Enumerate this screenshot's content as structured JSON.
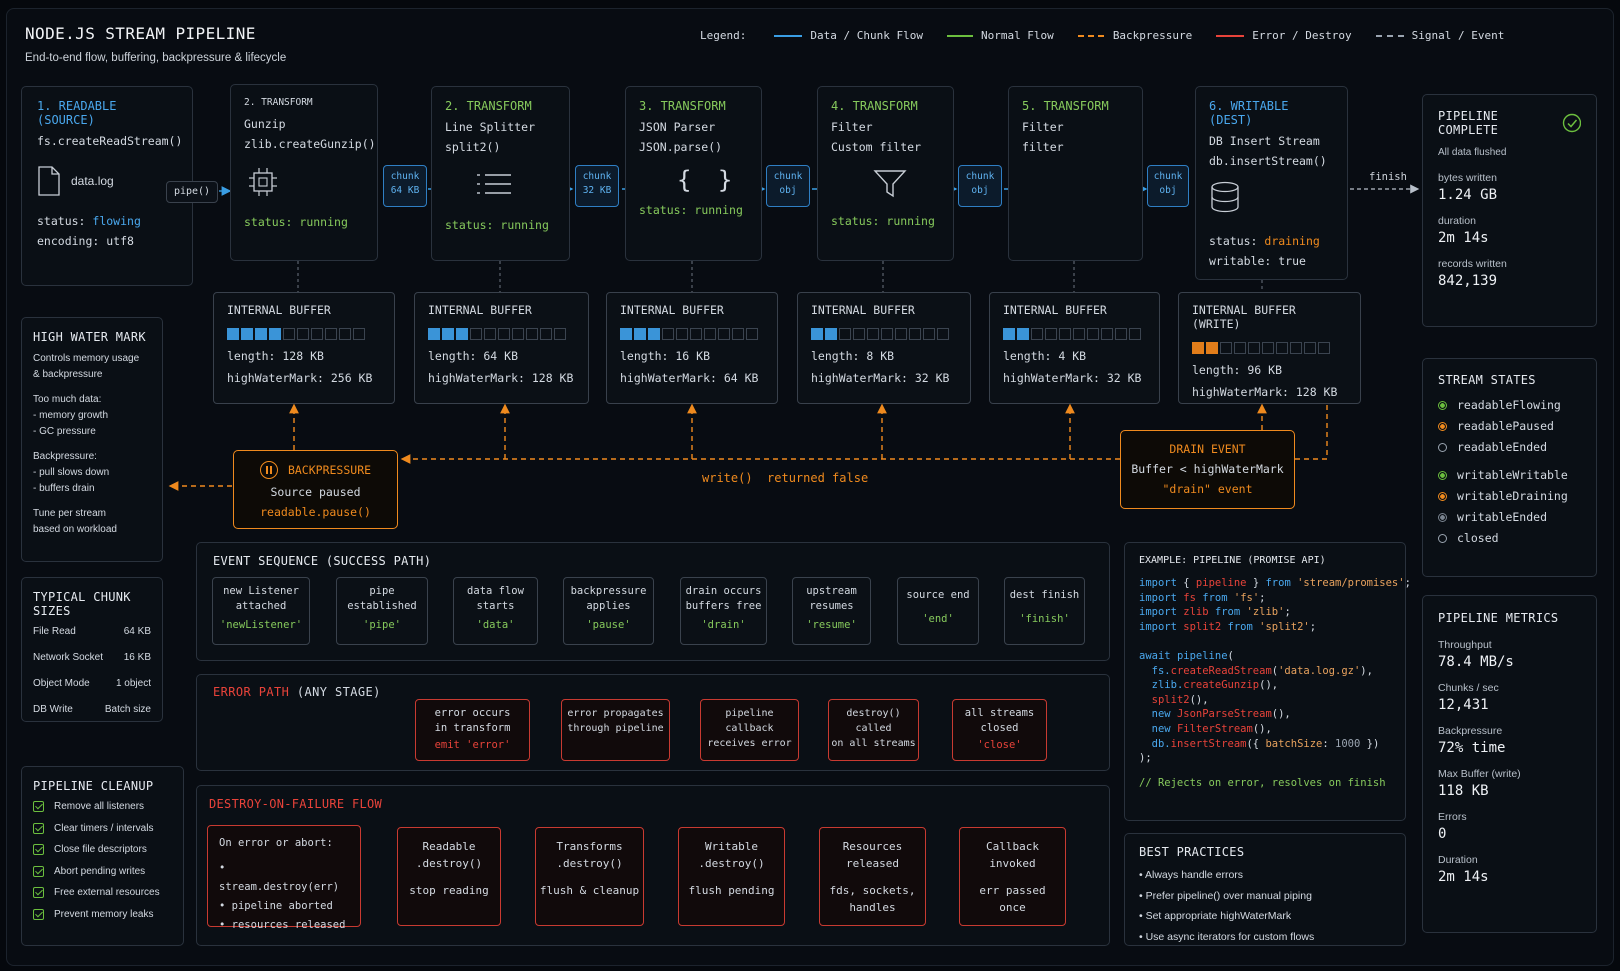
{
  "header": {
    "title": "NODE.JS STREAM PIPELINE",
    "subtitle": "End-to-end flow, buffering, backpressure & lifecycle"
  },
  "legend": {
    "label": "Legend:",
    "items": [
      {
        "label": "Data / Chunk Flow",
        "color": "#3a9ee4",
        "style": "solid"
      },
      {
        "label": "Normal Flow",
        "color": "#6cbf3e",
        "style": "solid"
      },
      {
        "label": "Backpressure",
        "color": "#ef8a1e",
        "style": "dashed"
      },
      {
        "label": "Error / Destroy",
        "color": "#e8433a",
        "style": "solid"
      },
      {
        "label": "Signal / Event",
        "color": "#9aa4b0",
        "style": "dashed"
      }
    ]
  },
  "source": {
    "title": "1. READABLE (SOURCE)",
    "api": "fs.createReadStream()",
    "file": "data.log",
    "status_label": "status:",
    "status": "flowing",
    "encoding": "encoding: utf8",
    "pipe": "pipe()"
  },
  "stages": [
    {
      "title": "2. TRANSFORM",
      "name": "Gunzip",
      "api": "zlib.createGunzip()",
      "icon": "cpu-icon",
      "status_label": "status:",
      "status": "running"
    },
    {
      "title": "2. TRANSFORM",
      "name": "Line Splitter",
      "api": "split2()",
      "icon": "list-icon",
      "status_label": "status:",
      "status": "running"
    },
    {
      "title": "3. TRANSFORM",
      "name": "JSON Parser",
      "api": "JSON.parse()",
      "icon": "braces-icon",
      "status_label": "status:",
      "status": "running"
    },
    {
      "title": "4. TRANSFORM",
      "name": "Filter",
      "api": "Custom filter",
      "icon": "funnel-icon",
      "status_label": "status:",
      "status": "running"
    },
    {
      "title": "5. TRANSFORM",
      "name": "Filter",
      "api": "filter",
      "icon": "",
      "status_label": "",
      "status": ""
    }
  ],
  "chunks": [
    {
      "l1": "chunk",
      "l2": "64 KB"
    },
    {
      "l1": "chunk",
      "l2": "32 KB"
    },
    {
      "l1": "chunk",
      "l2": "obj"
    },
    {
      "l1": "chunk",
      "l2": "obj"
    },
    {
      "l1": "chunk",
      "l2": "obj"
    }
  ],
  "writable": {
    "title": "6. WRITABLE (DEST)",
    "name": "DB Insert Stream",
    "api": "db.insertStream()",
    "status_label": "status:",
    "status": "draining",
    "writable": "writable: true",
    "finish": "finish"
  },
  "buffers": [
    {
      "title": "INTERNAL BUFFER",
      "length": "length: 128 KB",
      "hwm": "highWaterMark: 256 KB",
      "fill": 4
    },
    {
      "title": "INTERNAL BUFFER",
      "length": "length: 64 KB",
      "hwm": "highWaterMark: 128 KB",
      "fill": 3
    },
    {
      "title": "INTERNAL BUFFER",
      "length": "length: 16 KB",
      "hwm": "highWaterMark: 64 KB",
      "fill": 3
    },
    {
      "title": "INTERNAL BUFFER",
      "length": "length: 8 KB",
      "hwm": "highWaterMark: 32 KB",
      "fill": 2
    },
    {
      "title": "INTERNAL BUFFER",
      "length": "length: 4 KB",
      "hwm": "highWaterMark: 32 KB",
      "fill": 2
    },
    {
      "title": "INTERNAL BUFFER (WRITE)",
      "length": "length: 96 KB",
      "hwm": "highWaterMark: 128 KB",
      "fill": 2
    }
  ],
  "backpressure": {
    "title": "BACKPRESSURE",
    "l1": "Source paused",
    "l2": "readable.pause()",
    "note": "write()  returned false"
  },
  "drain": {
    "title": "DRAIN EVENT",
    "l1": "Buffer < highWaterMark",
    "l2": "\"drain\" event"
  },
  "hwm_panel": {
    "title": "HIGH WATER MARK",
    "desc1": "Controls memory usage",
    "desc2": "& backpressure",
    "h1": "Too much data:",
    "b1": "- memory growth",
    "b2": "- GC pressure",
    "h2": "Backpressure:",
    "b3": "- pull slows down",
    "b4": "- buffers drain",
    "t1": "Tune per stream",
    "t2": "based on workload"
  },
  "chunk_sizes": {
    "title": "TYPICAL CHUNK SIZES",
    "rows": [
      [
        "File Read",
        "64 KB"
      ],
      [
        "Network Socket",
        "16 KB"
      ],
      [
        "Object Mode",
        "1 object"
      ],
      [
        "DB Write",
        "Batch size"
      ]
    ]
  },
  "cleanup": {
    "title": "PIPELINE CLEANUP",
    "items": [
      "Remove all listeners",
      "Clear timers / intervals",
      "Close file descriptors",
      "Abort pending writes",
      "Free external resources",
      "Prevent memory leaks"
    ]
  },
  "events": {
    "title": "EVENT SEQUENCE (SUCCESS PATH)",
    "items": [
      {
        "l1": "new Listener",
        "l2": "attached",
        "c": "'newListener'"
      },
      {
        "l1": "pipe",
        "l2": "established",
        "c": "'pipe'"
      },
      {
        "l1": "data flow",
        "l2": "starts",
        "c": "'data'"
      },
      {
        "l1": "backpressure",
        "l2": "applies",
        "c": "'pause'"
      },
      {
        "l1": "drain occurs",
        "l2": "buffers free",
        "c": "'drain'"
      },
      {
        "l1": "upstream",
        "l2": "resumes",
        "c": "'resume'"
      },
      {
        "l1": "source end",
        "l2": "",
        "c": "'end'"
      },
      {
        "l1": "dest finish",
        "l2": "",
        "c": "'finish'"
      }
    ]
  },
  "error_path": {
    "title": "ERROR PATH",
    "title2": "(ANY STAGE)",
    "items": [
      {
        "l1": "error occurs",
        "l2": "in transform",
        "c": "emit 'error'"
      },
      {
        "l1": "error propagates",
        "l2": "through pipeline",
        "c": ""
      },
      {
        "l1": "pipeline callback",
        "l2": "receives error",
        "c": ""
      },
      {
        "l1": "destroy() called",
        "l2": "on all streams",
        "c": ""
      },
      {
        "l1": "all streams",
        "l2": "closed",
        "c": "'close'"
      }
    ]
  },
  "destroy": {
    "title": "DESTROY-ON-FAILURE FLOW",
    "first": {
      "h": "On error or abort:",
      "b": [
        "stream.destroy(err)",
        "pipeline aborted",
        "resources released"
      ]
    },
    "items": [
      {
        "l1": "Readable",
        "l2": ".destroy()",
        "d1": "stop reading",
        "d2": ""
      },
      {
        "l1": "Transforms",
        "l2": ".destroy()",
        "d1": "flush & cleanup",
        "d2": ""
      },
      {
        "l1": "Writable",
        "l2": ".destroy()",
        "d1": "flush pending",
        "d2": ""
      },
      {
        "l1": "Resources",
        "l2": "released",
        "d1": "fds, sockets,",
        "d2": "handles"
      },
      {
        "l1": "Callback",
        "l2": "invoked",
        "d1": "err passed",
        "d2": "once"
      }
    ]
  },
  "example": {
    "title": "EXAMPLE: PIPELINE (PROMISE API)",
    "comment": "// Rejects on error, resolves on finish"
  },
  "practices": {
    "title": "BEST PRACTICES",
    "items": [
      "Always handle errors",
      "Prefer pipeline() over manual piping",
      "Set appropriate highWaterMark",
      "Use async iterators for custom flows"
    ]
  },
  "complete": {
    "title": "PIPELINE COMPLETE",
    "sub": "All data flushed",
    "rows": [
      [
        "bytes written",
        "1.24 GB"
      ],
      [
        "duration",
        "2m 14s"
      ],
      [
        "records written",
        "842,139"
      ]
    ]
  },
  "states": {
    "title": "STREAM STATES",
    "items": [
      {
        "label": "readableFlowing",
        "color": "#6cbf3e",
        "kind": "ring-fill"
      },
      {
        "label": "readablePaused",
        "color": "#ef8a1e",
        "kind": "ring-fill"
      },
      {
        "label": "readableEnded",
        "color": "#9aa4b0",
        "kind": "ring"
      },
      {
        "label": "writableWritable",
        "color": "#6cbf3e",
        "kind": "ring-fill"
      },
      {
        "label": "writableDraining",
        "color": "#ef8a1e",
        "kind": "ring-fill"
      },
      {
        "label": "writableEnded",
        "color": "#7a8490",
        "kind": "ring-fill"
      },
      {
        "label": "closed",
        "color": "#9aa4b0",
        "kind": "ring"
      }
    ]
  },
  "metrics": {
    "title": "PIPELINE METRICS",
    "rows": [
      [
        "Throughput",
        "78.4 MB/s"
      ],
      [
        "Chunks / sec",
        "12,431"
      ],
      [
        "Backpressure",
        "72% time"
      ],
      [
        "Max Buffer (write)",
        "118 KB"
      ],
      [
        "Errors",
        "0"
      ],
      [
        "Duration",
        "2m 14s"
      ]
    ]
  }
}
